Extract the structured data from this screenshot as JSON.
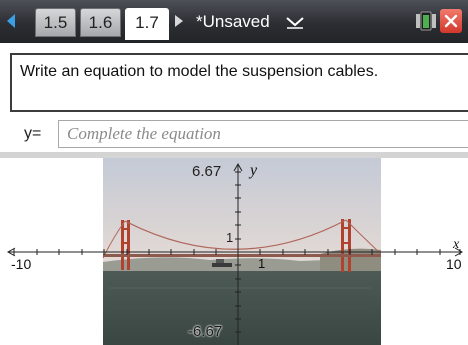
{
  "topbar": {
    "tabs": [
      {
        "label": "1.5",
        "active": false
      },
      {
        "label": "1.6",
        "active": false
      },
      {
        "label": "1.7",
        "active": true
      }
    ],
    "document_title": "*Unsaved",
    "icons": [
      "nav-left-arrow",
      "nav-right-arrow",
      "dropdown-chevron",
      "battery",
      "close"
    ],
    "colors": {
      "nav_arrow": "#3aa0e6",
      "close": "#d2382b",
      "battery": "#4caf50"
    }
  },
  "question": {
    "text": "Write an equation to model the suspension cables."
  },
  "answer": {
    "prefix": "y=",
    "placeholder": "Complete the equation",
    "value": ""
  },
  "graph": {
    "y_max_label": "6.67",
    "y_min_label": "-6.67",
    "x_min_label": "-10",
    "x_max_label": "10",
    "x_axis_label": "x",
    "y_axis_label": "y",
    "x_unit_label": "1",
    "y_unit_label": "1",
    "x_range": [
      -10,
      10
    ],
    "y_range": [
      -6.67,
      6.67
    ],
    "background": "photo of suspension bridge over water"
  }
}
